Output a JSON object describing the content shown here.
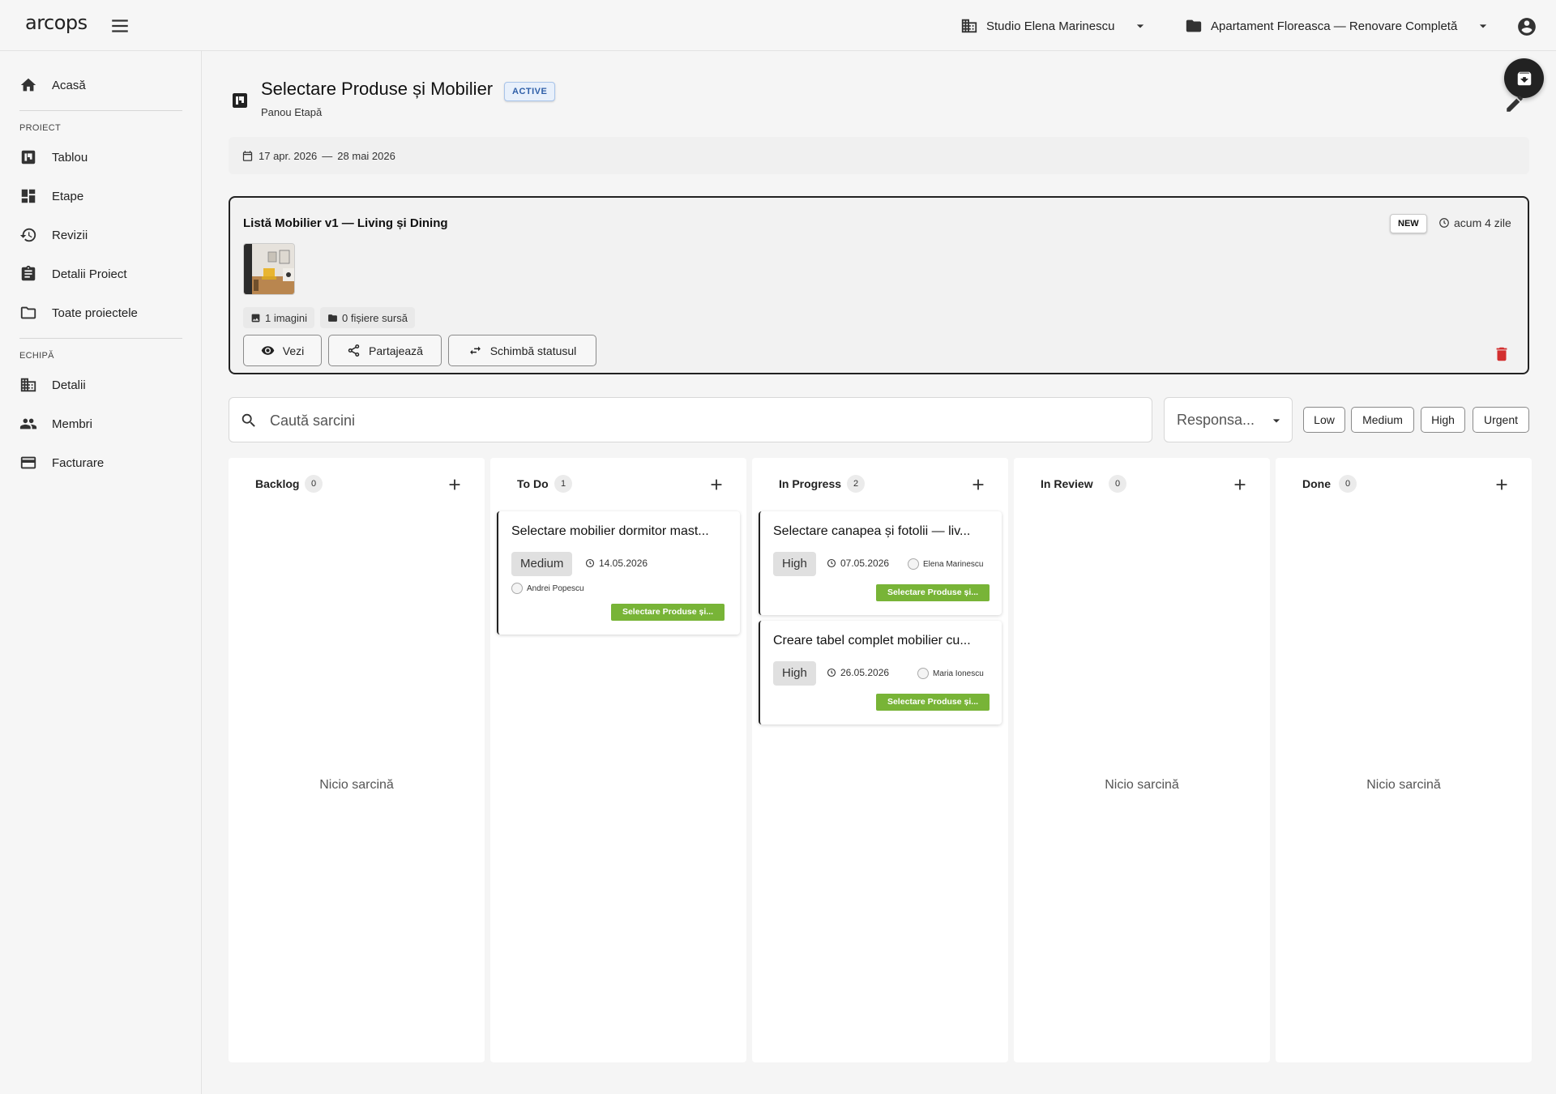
{
  "topbar": {
    "logo": "arcops",
    "workspace": "Studio Elena Marinescu",
    "project": "Apartament Floreasca — Renovare Completă"
  },
  "sidebar": {
    "home": "Acasă",
    "section_project": "PROIECT",
    "project_items": [
      "Tablou",
      "Etape",
      "Revizii",
      "Detalii Proiect",
      "Toate proiectele"
    ],
    "section_team": "ECHIPĂ",
    "team_items": [
      "Detalii",
      "Membri",
      "Facturare"
    ]
  },
  "page": {
    "title": "Selectare Produse și Mobilier",
    "status": "ACTIVE",
    "subtitle": "Panou Etapă",
    "date_start": "17 apr. 2026",
    "date_sep": "—",
    "date_end": "28 mai 2026"
  },
  "revision": {
    "title": "Listă Mobilier v1 — Living și Dining",
    "badge": "NEW",
    "time": "acum 4 zile",
    "images": "1 imagini",
    "source_files": "0 fișiere sursă",
    "actions": {
      "view": "Vezi",
      "share": "Partajează",
      "change_status": "Schimbă statusul"
    }
  },
  "filters": {
    "search_placeholder": "Caută sarcini",
    "assignee_placeholder": "Responsa...",
    "priorities": [
      "Low",
      "Medium",
      "High",
      "Urgent"
    ]
  },
  "board": {
    "empty_text": "Nicio sarcină",
    "columns": [
      {
        "title": "Backlog",
        "count": "0"
      },
      {
        "title": "To Do",
        "count": "1"
      },
      {
        "title": "In Progress",
        "count": "2"
      },
      {
        "title": "In Review",
        "count": "0"
      },
      {
        "title": "Done",
        "count": "0"
      }
    ],
    "tasks": {
      "todo_1": {
        "title": "Selectare mobilier dormitor mast...",
        "priority": "Medium",
        "due": "14.05.2026",
        "assignee": "Andrei Popescu",
        "stage": "Selectare Produse și..."
      },
      "progress_1": {
        "title": "Selectare canapea și fotolii — liv...",
        "priority": "High",
        "due": "07.05.2026",
        "assignee": "Elena Marinescu",
        "stage": "Selectare Produse și..."
      },
      "progress_2": {
        "title": "Creare tabel complet mobilier cu...",
        "priority": "High",
        "due": "26.05.2026",
        "assignee": "Maria Ionescu",
        "stage": "Selectare Produse și..."
      }
    }
  },
  "colors": {
    "stage_tag": "#78b437",
    "delete": "#d32f2f",
    "status_chip": "#2f5fa8"
  }
}
